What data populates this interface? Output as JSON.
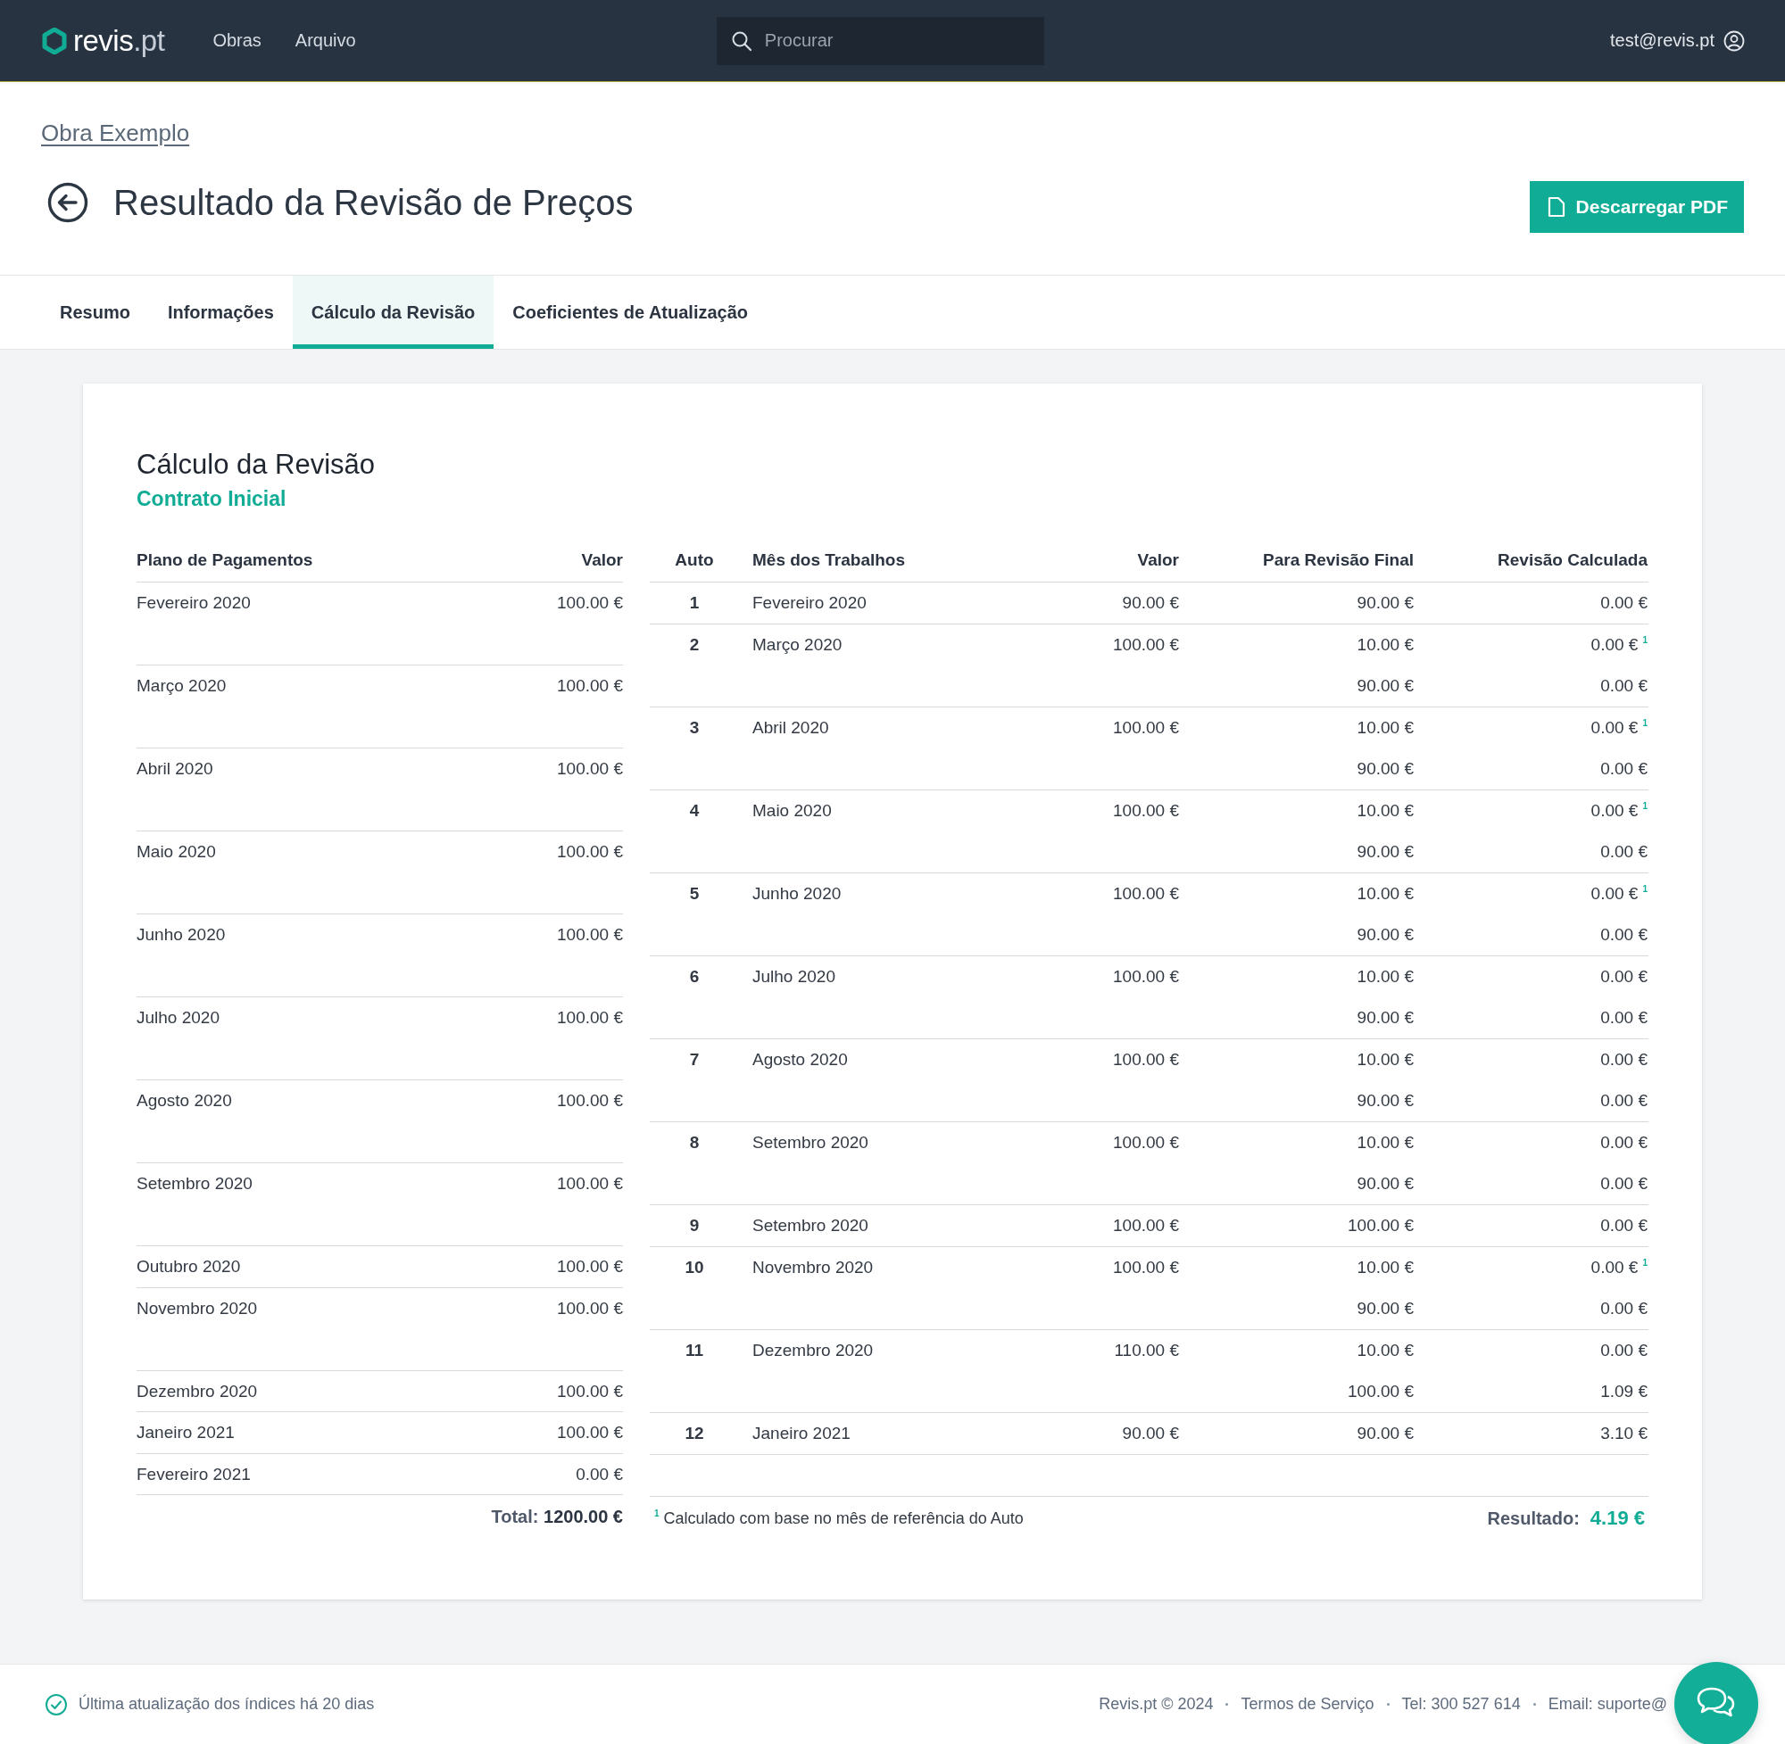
{
  "header": {
    "logo": {
      "name": "revis",
      "suffix": ".pt"
    },
    "nav": [
      "Obras",
      "Arquivo"
    ],
    "search": {
      "placeholder": "Procurar"
    },
    "user": "test@revis.pt"
  },
  "breadcrumb": "Obra Exemplo",
  "title": "Resultado da Revisão de Preços",
  "download_button": "Descarregar PDF",
  "tabs": [
    {
      "label": "Resumo",
      "selected": false
    },
    {
      "label": "Informações",
      "selected": false
    },
    {
      "label": "Cálculo da Revisão",
      "selected": true
    },
    {
      "label": "Coeficientes de Atualização",
      "selected": false
    }
  ],
  "card": {
    "title": "Cálculo da Revisão",
    "subtitle": "Contrato Inicial",
    "plan": {
      "columns": [
        "Plano de Pagamentos",
        "Valor"
      ],
      "rows": [
        {
          "month": "Fevereiro 2020",
          "value": "100.00 €"
        },
        {
          "month": "Março 2020",
          "value": "100.00 €"
        },
        {
          "month": "Abril 2020",
          "value": "100.00 €"
        },
        {
          "month": "Maio 2020",
          "value": "100.00 €"
        },
        {
          "month": "Junho 2020",
          "value": "100.00 €"
        },
        {
          "month": "Julho 2020",
          "value": "100.00 €"
        },
        {
          "month": "Agosto 2020",
          "value": "100.00 €"
        },
        {
          "month": "Setembro 2020",
          "value": "100.00 €"
        },
        {
          "month": "Outubro 2020",
          "value": "100.00 €"
        },
        {
          "month": "Novembro 2020",
          "value": "100.00 €"
        },
        {
          "month": "Dezembro 2020",
          "value": "100.00 €"
        },
        {
          "month": "Janeiro 2021",
          "value": "100.00 €"
        },
        {
          "month": "Fevereiro 2021",
          "value": "0.00 €"
        }
      ],
      "total": "Total: **1200.00 €**"
    },
    "autos": {
      "columns": [
        "Auto",
        "Mês dos Trabalhos",
        "Valor",
        "Para Revisão Final",
        "Revisão Calculada"
      ],
      "rows": [
        {
          "auto": "1",
          "month": "Fevereiro 2020",
          "value": "90.00 €",
          "lines": [
            {
              "final": "90.00 €",
              "calculated": "0.00 €"
            }
          ]
        },
        {
          "auto": "2",
          "month": "Março 2020",
          "value": "100.00 €",
          "lines": [
            {
              "final": "10.00 €",
              "calculated": "0.00 €$^{1}$"
            },
            {
              "final": "90.00 €",
              "calculated": "0.00 €"
            }
          ]
        },
        {
          "auto": "3",
          "month": "Abril 2020",
          "value": "100.00 €",
          "lines": [
            {
              "final": "10.00 €",
              "calculated": "0.00 €$^{1}$"
            },
            {
              "final": "90.00 €",
              "calculated": "0.00 €"
            }
          ]
        },
        {
          "auto": "4",
          "month": "Maio 2020",
          "value": "100.00 €",
          "lines": [
            {
              "final": "10.00 €",
              "calculated": "0.00 €$^{1}$"
            },
            {
              "final": "90.00 €",
              "calculated": "0.00 €"
            }
          ]
        },
        {
          "auto": "5",
          "month": "Junho 2020",
          "value": "100.00 €",
          "lines": [
            {
              "final": "10.00 €",
              "calculated": "0.00 €$^{1}$"
            },
            {
              "final": "90.00 €",
              "calculated": "0.00 €"
            }
          ]
        },
        {
          "auto": "6",
          "month": "Julho 2020",
          "value": "100.00 €",
          "lines": [
            {
              "final": "10.00 €",
              "calculated": "0.00 €"
            },
            {
              "final": "90.00 €",
              "calculated": "0.00 €"
            }
          ]
        },
        {
          "auto": "7",
          "month": "Agosto 2020",
          "value": "100.00 €",
          "lines": [
            {
              "final": "10.00 €",
              "calculated": "0.00 €"
            },
            {
              "final": "90.00 €",
              "calculated": "0.00 €"
            }
          ]
        },
        {
          "auto": "8",
          "month": "Setembro 2020",
          "value": "100.00 €",
          "lines": [
            {
              "final": "10.00 €",
              "calculated": "0.00 €"
            },
            {
              "final": "90.00 €",
              "calculated": "0.00 €"
            }
          ]
        },
        {
          "auto": "9",
          "month": "Setembro 2020",
          "value": "100.00 €",
          "lines": [
            {
              "final": "100.00 €",
              "calculated": "0.00 €"
            }
          ]
        },
        {
          "auto": "10",
          "month": "Novembro 2020",
          "value": "100.00 €",
          "lines": [
            {
              "final": "10.00 €",
              "calculated": "0.00 €$^{1}$"
            },
            {
              "final": "90.00 €",
              "calculated": "0.00 €"
            }
          ]
        },
        {
          "auto": "11",
          "month": "Dezembro 2020",
          "value": "110.00 €",
          "lines": [
            {
              "final": "10.00 €",
              "calculated": "0.00 €"
            },
            {
              "final": "100.00 €",
              "calculated": "1.09 €"
            }
          ]
        },
        {
          "auto": "12",
          "month": "Janeiro 2021",
          "value": "90.00 €",
          "lines": [
            {
              "final": "90.00 €",
              "calculated": "3.10 €"
            }
          ]
        }
      ],
      "footnote": "$^{1}$ Calculado com base no mês de referência do Auto",
      "result_label": "Resultado:",
      "result_value": "4.19 €"
    }
  },
  "footer": {
    "status": "Última atualização dos índices há 20 dias",
    "links": [
      "Revis.pt © 2024",
      "Termos de Serviço",
      "Tel: 300 527 614",
      "Email: suporte@"
    ]
  }
}
